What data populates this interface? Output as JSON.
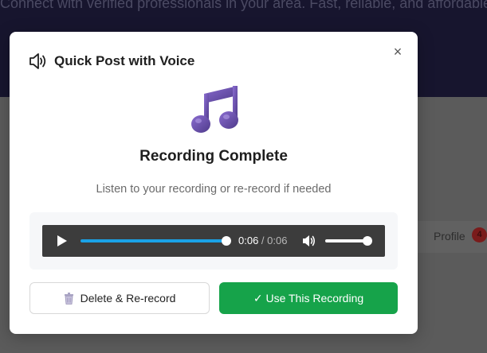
{
  "background": {
    "hero_text": "Connect with verified professionals in your area. Fast, reliable, and affordable.",
    "profile_label": "Profile",
    "profile_badge": "4"
  },
  "modal": {
    "title": "Quick Post with Voice",
    "close_symbol": "×",
    "status_title": "Recording Complete",
    "status_subtitle": "Listen to your recording or re-record if needed",
    "player": {
      "current_time": "0:06",
      "separator": " / ",
      "duration": "0:06",
      "progress": 1.0,
      "volume": 1.0
    },
    "delete_label": "Delete & Re-record",
    "use_label": "✓ Use This Recording"
  },
  "colors": {
    "accent_green": "#16a34a",
    "note_purple": "#6b4fa8",
    "seek_blue": "#1aa2e6"
  },
  "icons": [
    "speaker-icon",
    "close-icon",
    "music-note-icon",
    "play-icon",
    "volume-icon",
    "trash-icon"
  ]
}
